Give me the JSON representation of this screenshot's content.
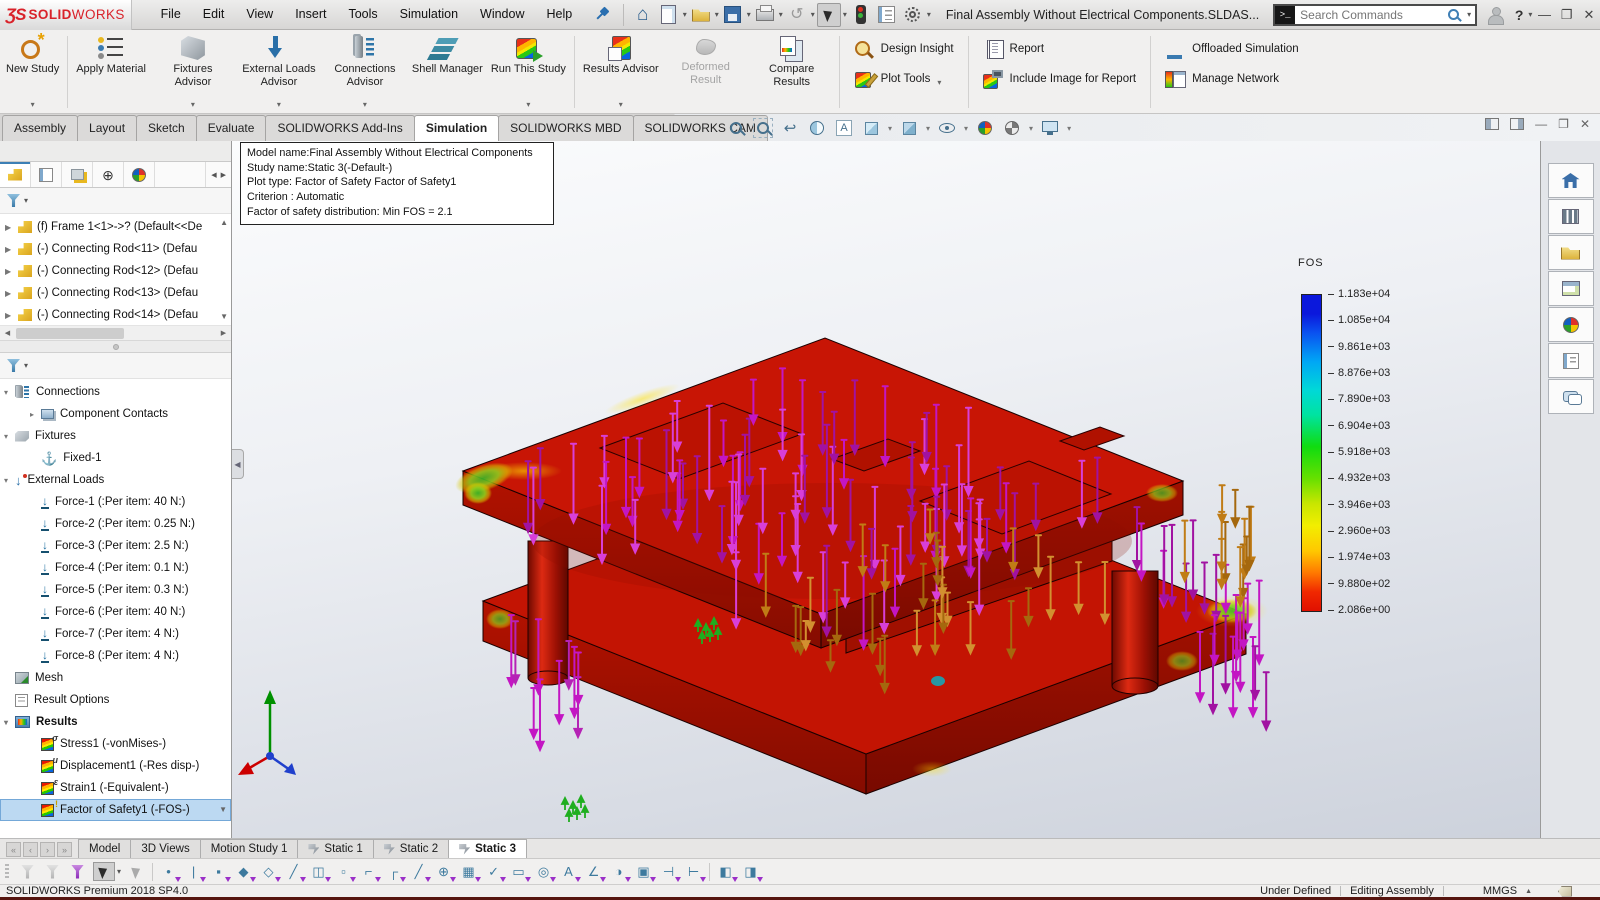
{
  "colors": {
    "brand_red": "#d9222a",
    "selection_blue": "#bcd9f2",
    "model_red": "#c81505",
    "arrow_magenta": "#c316c3",
    "arrow_orange": "#c07c16",
    "fixture_green": "#1fae1f",
    "legend_top_blue": "#0b18dc",
    "legend_bottom_red": "#e01000",
    "status_strip": "#56150f"
  },
  "titlebar": {
    "logo_mark": "ƷS",
    "logo_bold": "SOLID",
    "logo_light": "WORKS",
    "menus": [
      "File",
      "Edit",
      "View",
      "Insert",
      "Tools",
      "Simulation",
      "Window",
      "Help"
    ],
    "document_title": "Final Assembly Without Electrical Components.SLDAS...",
    "search": {
      "placeholder": "Search Commands"
    },
    "help_label": "?"
  },
  "quick_toolbar": [
    {
      "icon": "home"
    },
    {
      "icon": "new-document",
      "dropdown": true
    },
    {
      "icon": "open-document",
      "dropdown": true
    },
    {
      "icon": "save",
      "dropdown": true
    },
    {
      "icon": "print",
      "dropdown": true
    },
    {
      "icon": "undo",
      "dropdown": true
    },
    {
      "icon": "select",
      "dropdown": true
    },
    {
      "icon": "rebuild"
    },
    {
      "icon": "options-list"
    },
    {
      "icon": "settings",
      "dropdown": true
    }
  ],
  "ribbon": {
    "buttons": [
      {
        "label": "New Study",
        "icon": "new-study",
        "dropdown": true,
        "sep_after": true
      },
      {
        "label": "Apply Material",
        "icon": "apply-material"
      },
      {
        "label": "Fixtures Advisor",
        "icon": "fixtures-advisor",
        "dropdown": true
      },
      {
        "label": "External Loads Advisor",
        "icon": "external-loads-advisor",
        "dropdown": true
      },
      {
        "label": "Connections Advisor",
        "icon": "connections-advisor",
        "dropdown": true
      },
      {
        "label": "Shell Manager",
        "icon": "shell-manager"
      },
      {
        "label": "Run This Study",
        "icon": "run-this-study",
        "dropdown": true,
        "sep_after": true
      },
      {
        "label": "Results Advisor",
        "icon": "results-advisor",
        "dropdown": true
      },
      {
        "label": "Deformed Result",
        "icon": "deformed-result",
        "disabled": true
      },
      {
        "label": "Compare Results",
        "icon": "compare-results",
        "sep_after": true
      }
    ],
    "link_groups": [
      [
        {
          "label": "Design Insight",
          "icon": "design-insight"
        },
        {
          "label": "Plot Tools",
          "icon": "plot-tools",
          "dropdown": true
        }
      ],
      [
        {
          "label": "Report",
          "icon": "report"
        },
        {
          "label": "Include Image for Report",
          "icon": "include-image"
        }
      ],
      [
        {
          "label": "Offloaded Simulation",
          "icon": "offloaded-simulation"
        },
        {
          "label": "Manage Network",
          "icon": "manage-network"
        }
      ]
    ]
  },
  "command_tabs": {
    "items": [
      "Assembly",
      "Layout",
      "Sketch",
      "Evaluate",
      "SOLIDWORKS Add-Ins",
      "Simulation",
      "SOLIDWORKS MBD",
      "SOLIDWORKS CAM"
    ],
    "active": "Simulation"
  },
  "headsup_icons": [
    {
      "name": "zoom-to-fit"
    },
    {
      "name": "zoom-to-area"
    },
    {
      "name": "previous-view",
      "glyph": "↩"
    },
    {
      "name": "section-view"
    },
    {
      "name": "annotation-visibility",
      "glyph": "A"
    },
    {
      "name": "view-orientation",
      "dropdown": true
    },
    {
      "name": "display-style",
      "dropdown": true
    },
    {
      "name": "hide-show-items",
      "dropdown": true
    },
    {
      "name": "edit-appearance"
    },
    {
      "name": "apply-scene",
      "dropdown": true
    },
    {
      "name": "view-settings",
      "dropdown": true
    }
  ],
  "panel_tabs": [
    "featuremanager",
    "propertymanager",
    "configurationmanager",
    "dimxpertmanager",
    "displaymanager"
  ],
  "feature_tree": {
    "items": [
      "(f) Frame 1<1>->? (Default<<De",
      "(-) Connecting Rod<11> (Defau",
      "(-) Connecting Rod<12> (Defau",
      "(-) Connecting Rod<13> (Defau",
      "(-) Connecting Rod<14> (Defau"
    ]
  },
  "study_tree": {
    "items": [
      {
        "label": "Connections",
        "icon": "connections",
        "arrow": "exp",
        "level": 0
      },
      {
        "label": "Component Contacts",
        "icon": "contacts",
        "arrow": "col",
        "level": 1
      },
      {
        "label": "Fixtures",
        "icon": "fixtures",
        "arrow": "exp",
        "level": 0
      },
      {
        "label": "Fixed-1",
        "icon": "anchor",
        "level": 1
      },
      {
        "label": "External Loads",
        "icon": "loads",
        "arrow": "exp",
        "level": 0
      },
      {
        "label": "Force-1 (:Per item: 40 N:)",
        "icon": "force",
        "level": 1
      },
      {
        "label": "Force-2 (:Per item: 0.25 N:)",
        "icon": "force",
        "level": 1
      },
      {
        "label": "Force-3 (:Per item: 2.5 N:)",
        "icon": "force",
        "level": 1
      },
      {
        "label": "Force-4 (:Per item: 0.1 N:)",
        "icon": "force",
        "level": 1
      },
      {
        "label": "Force-5 (:Per item: 0.3 N:)",
        "icon": "force",
        "level": 1
      },
      {
        "label": "Force-6 (:Per item: 40 N:)",
        "icon": "force",
        "level": 1
      },
      {
        "label": "Force-7 (:Per item: 4 N:)",
        "icon": "force",
        "level": 1
      },
      {
        "label": "Force-8 (:Per item: 4 N:)",
        "icon": "force",
        "level": 1
      },
      {
        "label": "Mesh",
        "icon": "mesh",
        "level": 0
      },
      {
        "label": "Result Options",
        "icon": "options",
        "level": 0
      },
      {
        "label": "Results",
        "icon": "results",
        "arrow": "exp",
        "level": 0,
        "bold": true
      },
      {
        "label": "Stress1 (-vonMises-)",
        "icon": "plot-stress",
        "level": 1
      },
      {
        "label": "Displacement1 (-Res disp-)",
        "icon": "plot-disp",
        "level": 1
      },
      {
        "label": "Strain1 (-Equivalent-)",
        "icon": "plot-strain",
        "level": 1
      },
      {
        "label": "Factor of Safety1 (-FOS-)",
        "icon": "plot-fos",
        "level": 1,
        "selected": true
      }
    ]
  },
  "viewport": {
    "info_box": {
      "lines": [
        "Model name:Final Assembly Without Electrical Components",
        "Study name:Static 3(-Default-)",
        "Plot type: Factor of Safety Factor of Safety1",
        "Criterion : Automatic",
        "Factor of safety distribution: Min FOS = 2.1"
      ]
    },
    "legend": {
      "title": "FOS",
      "values": [
        "1.183e+04",
        "1.085e+04",
        "9.861e+03",
        "8.876e+03",
        "7.890e+03",
        "6.904e+03",
        "5.918e+03",
        "4.932e+03",
        "3.946e+03",
        "2.960e+03",
        "1.974e+03",
        "9.880e+02",
        "2.086e+00"
      ]
    }
  },
  "taskpane_icons": [
    "home",
    "design-library",
    "file-explorer",
    "view-palette",
    "appearances",
    "custom-properties",
    "forum"
  ],
  "bottom_tabs": {
    "items": [
      {
        "label": "Model"
      },
      {
        "label": "3D Views"
      },
      {
        "label": "Motion Study 1"
      },
      {
        "label": "Static 1",
        "icon": true
      },
      {
        "label": "Static 2",
        "icon": true
      },
      {
        "label": "Static 3",
        "icon": true,
        "active": true
      }
    ]
  },
  "filter_toolbar_icons": [
    {
      "name": "filter-vertices",
      "kind": "funnel f-gray"
    },
    {
      "name": "filter-edges",
      "kind": "funnel f-gray"
    },
    {
      "name": "filter-faces",
      "kind": "funnel f-purple"
    },
    {
      "name": "select-cursor",
      "kind": "cursor-dark"
    },
    {
      "name": "select-other",
      "kind": "cursor-gray"
    },
    {
      "name": "point-tool",
      "glyph": "•"
    },
    {
      "name": "line-tool",
      "glyph": "|"
    },
    {
      "name": "face-tool",
      "glyph": "▪"
    },
    {
      "name": "surface-tool",
      "glyph": "◆"
    },
    {
      "name": "solid-body-tool",
      "glyph": "◇"
    },
    {
      "name": "axis-tool",
      "glyph": "╱"
    },
    {
      "name": "plane-tool",
      "glyph": "◫"
    },
    {
      "name": "vertex-tool",
      "glyph": "▫"
    },
    {
      "name": "corner-tool",
      "glyph": "⌐"
    },
    {
      "name": "frame-tool",
      "glyph": "┌"
    },
    {
      "name": "edge-tool",
      "glyph": "╱"
    },
    {
      "name": "origin-tool",
      "glyph": "⊕"
    },
    {
      "name": "mesh-tool",
      "glyph": "▦"
    },
    {
      "name": "check-tool",
      "glyph": "✓"
    },
    {
      "name": "slot-tool",
      "glyph": "▭"
    },
    {
      "name": "magnifier-tool",
      "glyph": "◎"
    },
    {
      "name": "annotation-tool",
      "glyph": "A"
    },
    {
      "name": "angle-tool",
      "glyph": "∠"
    },
    {
      "name": "shading-tool",
      "glyph": "◑"
    },
    {
      "name": "panel-tool",
      "glyph": "▣"
    },
    {
      "name": "trim-left-tool",
      "glyph": "⊣"
    },
    {
      "name": "trim-right-tool",
      "glyph": "⊢"
    },
    {
      "name": "pane-a-tool",
      "glyph": "◧"
    },
    {
      "name": "pane-b-tool",
      "glyph": "◨"
    }
  ],
  "status_bar": {
    "left": "SOLIDWORKS Premium 2018 SP4.0",
    "items": [
      "Under Defined",
      "Editing Assembly"
    ],
    "units": "MMGS"
  }
}
